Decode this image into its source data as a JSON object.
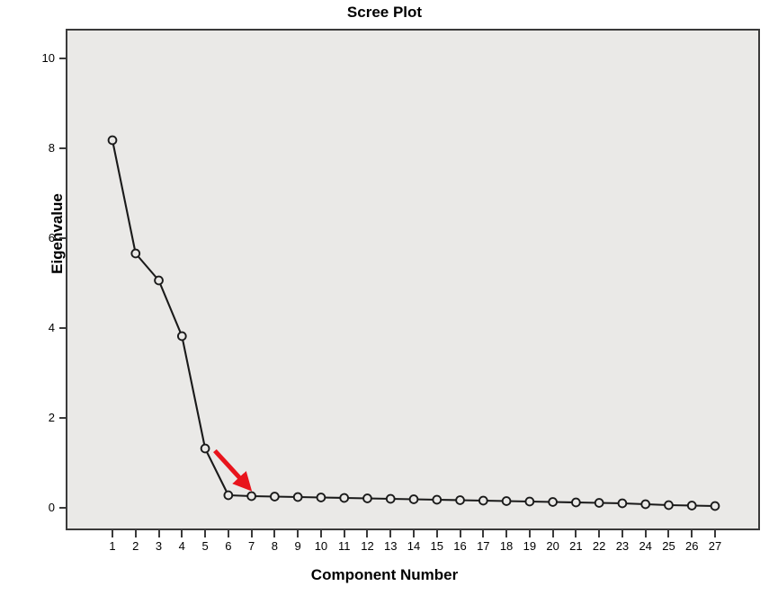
{
  "chart_data": {
    "type": "line",
    "title": "Scree Plot",
    "xlabel": "Component Number",
    "ylabel": "Eigenvalue",
    "x": [
      1,
      2,
      3,
      4,
      5,
      6,
      7,
      8,
      9,
      10,
      11,
      12,
      13,
      14,
      15,
      16,
      17,
      18,
      19,
      20,
      21,
      22,
      23,
      24,
      25,
      26,
      27
    ],
    "values": [
      8.18,
      5.66,
      5.06,
      3.82,
      1.32,
      0.28,
      0.26,
      0.25,
      0.24,
      0.23,
      0.22,
      0.21,
      0.2,
      0.19,
      0.18,
      0.17,
      0.16,
      0.15,
      0.14,
      0.13,
      0.12,
      0.11,
      0.1,
      0.08,
      0.06,
      0.05,
      0.04
    ],
    "xtick_labels": [
      "1",
      "2",
      "3",
      "4",
      "5",
      "6",
      "7",
      "8",
      "9",
      "10",
      "11",
      "12",
      "13",
      "14",
      "15",
      "16",
      "17",
      "18",
      "19",
      "20",
      "21",
      "22",
      "23",
      "24",
      "25",
      "26",
      "27"
    ],
    "ytick_labels": [
      "0",
      "2",
      "4",
      "6",
      "8",
      "10"
    ],
    "ytick_values": [
      0,
      2,
      4,
      6,
      8,
      10
    ],
    "xlim": [
      0.35,
      27.65
    ],
    "ylim": [
      -0.5,
      10.55
    ],
    "grid": false,
    "legend": null,
    "marker": "open-circle",
    "line_color": "#1a1a1a",
    "marker_fill": "#eae9e7",
    "plot_background": "#eae9e7",
    "figure_background": "#ffffff",
    "annotations": [
      {
        "kind": "arrow",
        "color": "#e8141c",
        "label": "elbow-arrow",
        "from_x": 5.42,
        "from_y": 1.27,
        "to_x": 6.68,
        "to_y": 0.56
      }
    ]
  }
}
